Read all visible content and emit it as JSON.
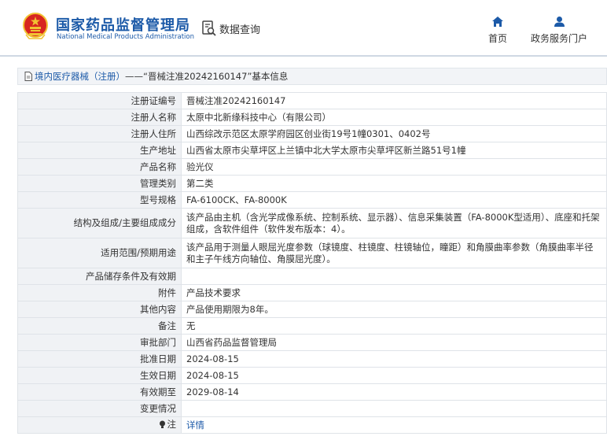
{
  "header": {
    "site_name_cn": "国家药品监督管理局",
    "site_name_en": "National Medical Products Administration",
    "query_label": "数据查询",
    "nav": [
      {
        "label": "首页",
        "icon": "home-icon"
      },
      {
        "label": "政务服务门户",
        "icon": "user-icon"
      }
    ]
  },
  "breadcrumb": {
    "category": "境内医疗器械（注册）",
    "separator": " —— ",
    "title": "“晋械注准20242160147”基本信息"
  },
  "rows": [
    {
      "key": "注册证编号",
      "value": "晋械注准20242160147"
    },
    {
      "key": "注册人名称",
      "value": "太原中北新缘科技中心（有限公司）"
    },
    {
      "key": "注册人住所",
      "value": "山西综改示范区太原学府园区创业街19号1幢0301、0402号"
    },
    {
      "key": "生产地址",
      "value": "山西省太原市尖草坪区上兰镇中北大学太原市尖草坪区新兰路51号1幢"
    },
    {
      "key": "产品名称",
      "value": "验光仪"
    },
    {
      "key": "管理类别",
      "value": "第二类"
    },
    {
      "key": "型号规格",
      "value": "FA-6100CK、FA-8000K"
    },
    {
      "key": "结构及组成/主要组成成分",
      "value": "该产品由主机（含光学成像系统、控制系统、显示器）、信息采集装置（FA-8000K型适用）、底座和托架组成，含软件组件（软件发布版本：4）。"
    },
    {
      "key": "适用范围/预期用途",
      "value": "该产品用于测量人眼屈光度参数（球镜度、柱镜度、柱镜轴位，瞳距）和角膜曲率参数（角膜曲率半径和主子午线方向轴位、角膜屈光度）。"
    },
    {
      "key": "产品储存条件及有效期",
      "value": ""
    },
    {
      "key": "附件",
      "value": "产品技术要求"
    },
    {
      "key": "其他内容",
      "value": "产品使用期限为8年。"
    },
    {
      "key": "备注",
      "value": "无"
    },
    {
      "key": "审批部门",
      "value": "山西省药品监督管理局"
    },
    {
      "key": "批准日期",
      "value": "2024-08-15"
    },
    {
      "key": "生效日期",
      "value": "2024-08-15"
    },
    {
      "key": "有效期至",
      "value": "2029-08-14"
    },
    {
      "key": "变更情况",
      "value": ""
    }
  ],
  "note_row": {
    "key": "注",
    "link_label": "详情"
  },
  "colors": {
    "brand_blue": "#1c5aa8",
    "label_bg": "#f0f2f5",
    "border": "#dfe3e8",
    "emblem_red": "#d7261f",
    "emblem_gold": "#f1c232"
  }
}
